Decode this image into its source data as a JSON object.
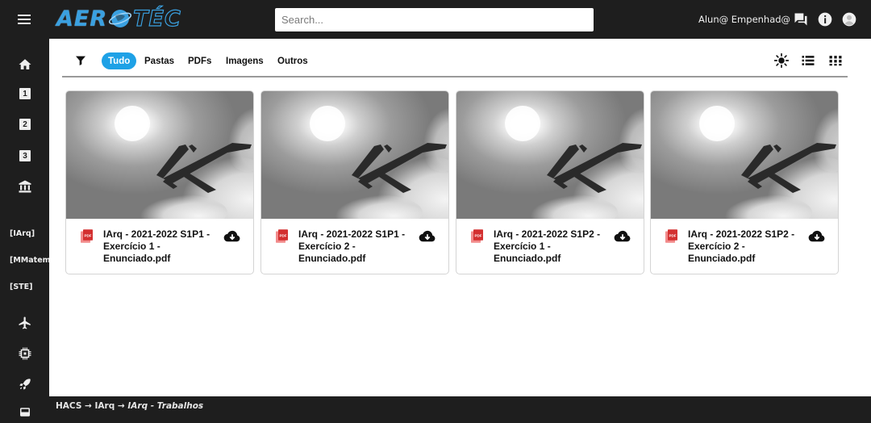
{
  "app": {
    "logo_left": "AER",
    "logo_right": "TÉC"
  },
  "search": {
    "placeholder": "Search...",
    "value": ""
  },
  "user": {
    "name": "Alun@ Empenhad@"
  },
  "sidebar": {
    "items": [
      {
        "icon": "home-icon"
      },
      {
        "icon": "number-1-icon",
        "label": "1"
      },
      {
        "icon": "number-2-icon",
        "label": "2"
      },
      {
        "icon": "number-3-icon",
        "label": "3"
      },
      {
        "icon": "institution-icon"
      },
      {
        "label": "[IArq]"
      },
      {
        "label": "[MMatem]"
      },
      {
        "label": "[STE]"
      },
      {
        "icon": "airplane-icon"
      },
      {
        "icon": "chip-icon"
      },
      {
        "icon": "rocket-icon"
      },
      {
        "icon": "bus-icon"
      }
    ]
  },
  "filters": {
    "tabs": [
      "Tudo",
      "Pastas",
      "PDFs",
      "Imagens",
      "Outros"
    ],
    "active": "Tudo"
  },
  "files": [
    {
      "title": "IArq - 2021-2022 S1P1 - Exercício 1 - Enunciado.pdf"
    },
    {
      "title": "IArq - 2021-2022 S1P1 - Exercício 2 - Enunciado.pdf"
    },
    {
      "title": "IArq - 2021-2022 S1P2 - Exercício 1 - Enunciado.pdf"
    },
    {
      "title": "IArq - 2021-2022 S1P2 - Exercício 2 - Enunciado.pdf"
    }
  ],
  "breadcrumb": {
    "root": "HACS",
    "sep": "→",
    "level1": "IArq",
    "current": "IArq - Trabalhos"
  },
  "colors": {
    "accent": "#1ea1e6",
    "brand": "#3aa0e0",
    "pdf_red": "#d32f2f",
    "chrome": "#1e1e1e"
  }
}
